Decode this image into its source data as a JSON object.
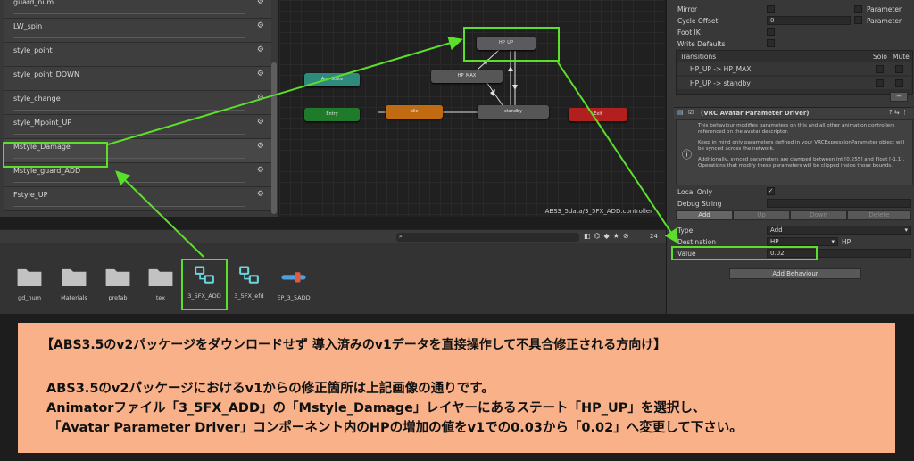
{
  "layers": [
    "guard_num",
    "LW_spin",
    "style_point",
    "style_point_DOWN",
    "style_change",
    "style_Mpoint_UP",
    "Mstyle_Damage",
    "Mstyle_guard_ADD",
    "Fstyle_UP"
  ],
  "graph": {
    "nodes": {
      "hp_up": "HP_UP",
      "hp_max": "HP_MAX",
      "any_state": "Any State",
      "entry": "Entry",
      "idle": "idle",
      "standby": "standby",
      "exit": "Exit"
    },
    "path": "ABS3_5data/3_5FX_ADD.controller"
  },
  "inspector": {
    "mirror": "Mirror",
    "cycle_offset": "Cycle Offset",
    "cycle_offset_value": "0",
    "foot_ik": "Foot IK",
    "write_defaults": "Write Defaults",
    "parameter_label": "Parameter",
    "transitions_title": "Transitions",
    "solo": "Solo",
    "mute": "Mute",
    "transitions": [
      "HP_UP -> HP_MAX",
      "HP_UP -> standby"
    ],
    "minus": "−",
    "component_title": "(VRC Avatar Parameter Driver)",
    "help1": "This behaviour modifies parameters on this and all other animation controllers referenced on the avatar descriptor.",
    "help2": "Keep in mind only parameters defined in your VRCExpressionParameter object will be synced across the network.",
    "help3": "Additionally, synced parameters are clamped between Int [0,255] and Float [-1,1]. Operations that modify these parameters will be clipped inside those bounds.",
    "local_only": "Local Only",
    "debug_string": "Debug String",
    "buttons": {
      "add": "Add",
      "up": "Up",
      "down": "Down",
      "delete": "Delete"
    },
    "type_label": "Type",
    "type_value": "Add",
    "destination_label": "Destination",
    "destination_value": "HP",
    "destination_name": "HP",
    "value_label": "Value",
    "value_value": "0.02",
    "add_behaviour": "Add Behaviour"
  },
  "toolbar": {
    "count": "24"
  },
  "assets": [
    "gd_num",
    "Materials",
    "prefab",
    "tex",
    "3_5FX_ADD",
    "3_5FX_efd",
    "EP_3_5ADD"
  ],
  "note": {
    "title": "【ABS3.5のv2パッケージをダウンロードせず 導入済みのv1データを直接操作して不具合修正される方向け】",
    "line1": "ABS3.5のv2パッケージにおけるv1からの修正箇所は上記画像の通りです。",
    "line2": "Animatorファイル「3_5FX_ADD」の「Mstyle_Damage」レイヤーにあるステート「HP_UP」を選択し、",
    "line3": "「Avatar Parameter Driver」コンポーネント内のHPの増加の値をv1での0.03から「0.02」へ変更して下さい。"
  },
  "colors": {
    "highlight": "#5cdf2a",
    "note_bg": "#f8b189",
    "entry": "#1f7a2b",
    "idle": "#c06a12",
    "exit": "#b21f1f",
    "any": "#2e8a7a"
  }
}
